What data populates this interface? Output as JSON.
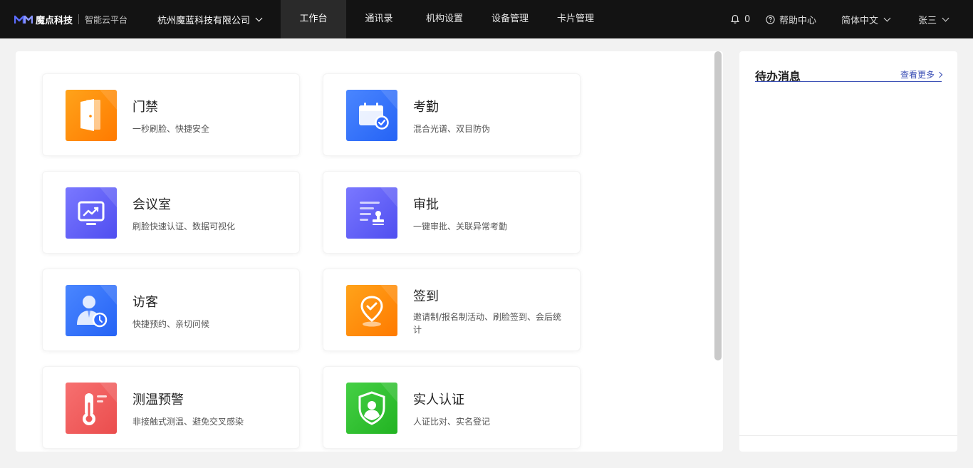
{
  "brand": {
    "name": "魔点科技",
    "subtitle": "智能云平台",
    "accent": "#5b6cff"
  },
  "company": {
    "name": "杭州魔蓝科技有限公司"
  },
  "nav": [
    {
      "label": "工作台",
      "active": true
    },
    {
      "label": "通讯录"
    },
    {
      "label": "机构设置"
    },
    {
      "label": "设备管理"
    },
    {
      "label": "卡片管理"
    }
  ],
  "toolbar": {
    "notification_count": "0",
    "help_label": "帮助中心",
    "language_label": "简体中文",
    "user_name": "张三"
  },
  "apps": [
    {
      "title": "门禁",
      "desc": "一秒刷脸、快捷安全",
      "icon": "door-icon",
      "color": "#ff8a00"
    },
    {
      "title": "考勤",
      "desc": "混合光谱、双目防伪",
      "icon": "calendar-check-icon",
      "color": "#2f6bff"
    },
    {
      "title": "会议室",
      "desc": "刷脸快速认证、数据可视化",
      "icon": "monitor-chart-icon",
      "color": "#5d5cf5"
    },
    {
      "title": "审批",
      "desc": "一键审批、关联异常考勤",
      "icon": "document-stamp-icon",
      "color": "#5d5cf5"
    },
    {
      "title": "访客",
      "desc": "快捷预约、亲切问候",
      "icon": "visitor-clock-icon",
      "color": "#2f6bff"
    },
    {
      "title": "签到",
      "desc": "邀请制/报名制活动、刷脸签到、会后统计",
      "icon": "location-check-icon",
      "color": "#ff8a00"
    },
    {
      "title": "测温预警",
      "desc": "非接触式测温、避免交叉感染",
      "icon": "thermometer-icon",
      "color": "#f05a5a"
    },
    {
      "title": "实人认证",
      "desc": "人证比对、实名登记",
      "icon": "shield-user-icon",
      "color": "#2ec12e"
    }
  ],
  "todo": {
    "title": "待办消息",
    "more_label": "查看更多"
  }
}
